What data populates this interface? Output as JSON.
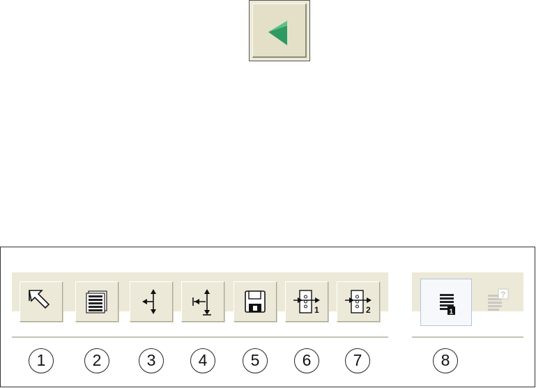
{
  "top_button": {
    "icon": "green-left-triangle-icon",
    "color": "#2e9a62"
  },
  "toolbar": {
    "buttons": [
      {
        "icon": "select-arrow-icon",
        "number": "1"
      },
      {
        "icon": "list-pages-icon",
        "number": "2"
      },
      {
        "icon": "move-cross-icon",
        "number": "3"
      },
      {
        "icon": "move-limit-icon",
        "number": "4"
      },
      {
        "icon": "floppy-save-icon",
        "number": "5"
      },
      {
        "icon": "insert-block-1-icon",
        "number": "6",
        "badge": "1"
      },
      {
        "icon": "insert-block-2-icon",
        "number": "7",
        "badge": "2"
      }
    ],
    "group2": {
      "active_button": {
        "icon": "list-1-icon",
        "badge": "1"
      },
      "disabled_button": {
        "icon": "list-help-icon",
        "badge": "?"
      },
      "number": "8"
    }
  }
}
